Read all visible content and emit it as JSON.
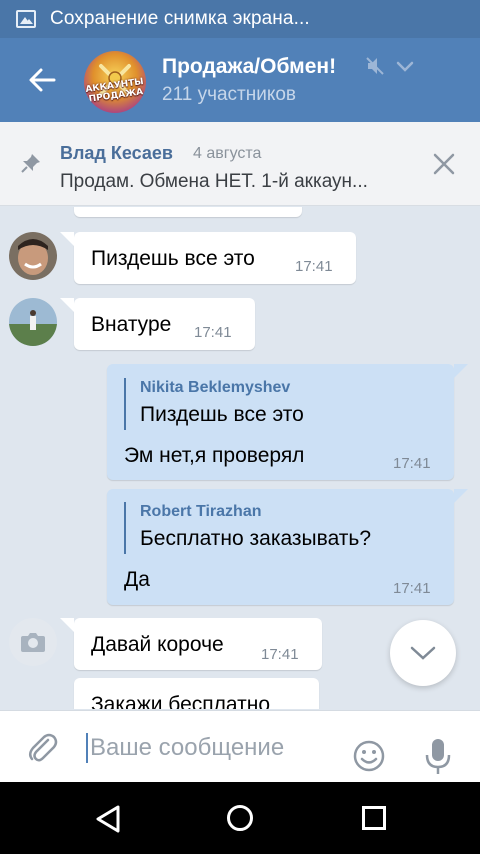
{
  "status_bar": {
    "notification": "Сохранение снимка экрана..."
  },
  "header": {
    "title": "Продажа/Обмен!",
    "subtitle": "211 участников",
    "avatar_text": "АККАУНТЫ\nПРОДАЖА"
  },
  "pinned": {
    "author": "Влад Кесаев",
    "date": "4 августа",
    "text": "Продам. Обмена НЕТ.  1-й аккаун..."
  },
  "messages": [
    {
      "direction": "in",
      "text": "Пиздешь все это",
      "time": "17:41"
    },
    {
      "direction": "in",
      "text": "Внатуре",
      "time": "17:41"
    },
    {
      "direction": "out",
      "quote_author": "Nikita Beklemyshev",
      "quote_text": "Пиздешь все это",
      "text": "Эм нет,я проверял",
      "time": "17:41"
    },
    {
      "direction": "out",
      "quote_author": "Robert Tirazhan",
      "quote_text": "Бесплатно заказывать?",
      "text": "Да",
      "time": "17:41"
    },
    {
      "direction": "in",
      "text": "Давай короче",
      "time": "17:41"
    },
    {
      "direction": "in",
      "text": "Закажи бесплатно",
      "time": ""
    }
  ],
  "input": {
    "placeholder": "Ваше сообщение"
  },
  "colors": {
    "header": "#5181b8",
    "status": "#4a76a8",
    "out_bubble": "#cce0f5",
    "chat_bg": "#dfe6ee"
  },
  "icons": [
    "back-arrow-icon",
    "mute-icon",
    "chevron-down-icon",
    "pin-icon",
    "close-icon",
    "camera-icon",
    "attach-icon",
    "smile-icon",
    "mic-icon"
  ]
}
